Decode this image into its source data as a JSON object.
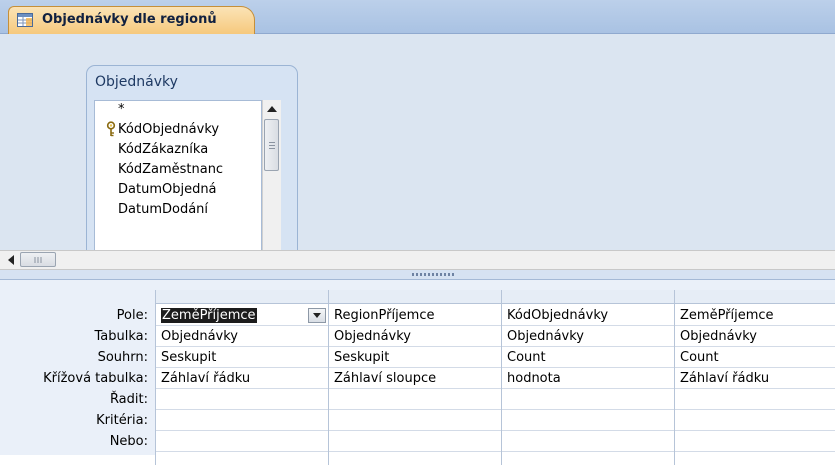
{
  "window": {
    "tab_title": "Objednávky dle regionů",
    "tab_icon": "query-design-icon"
  },
  "table_box": {
    "title": "Objednávky",
    "fields": [
      {
        "label": "*",
        "is_key": false
      },
      {
        "label": "KódObjednávky",
        "is_key": true
      },
      {
        "label": "KódZákazníka",
        "is_key": false
      },
      {
        "label": "KódZaměstnanc",
        "is_key": false
      },
      {
        "label": "DatumObjedná",
        "is_key": false
      },
      {
        "label": "DatumDodání",
        "is_key": false
      }
    ]
  },
  "grid": {
    "row_labels": [
      "Pole:",
      "Tabulka:",
      "Souhrn:",
      "Křížová tabulka:",
      "Řadit:",
      "Kritéria:",
      "Nebo:"
    ],
    "columns": [
      {
        "pole": "ZeměPříjemce",
        "tabulka": "Objednávky",
        "souhrn": "Seskupit",
        "krizova": "Záhlaví řádku",
        "selected": true
      },
      {
        "pole": "RegionPříjemce",
        "tabulka": "Objednávky",
        "souhrn": "Seskupit",
        "krizova": "Záhlaví sloupce",
        "selected": false
      },
      {
        "pole": "KódObjednávky",
        "tabulka": "Objednávky",
        "souhrn": "Count",
        "krizova": "hodnota",
        "selected": false
      },
      {
        "pole": "ZeměPříjemce",
        "tabulka": "Objednávky",
        "souhrn": "Count",
        "krizova": "Záhlaví řádku",
        "selected": false
      }
    ]
  },
  "colors": {
    "tab_fill": "#f6c97d",
    "upper_pane": "#dbe5f1",
    "grid_background": "#eaf0f9"
  }
}
